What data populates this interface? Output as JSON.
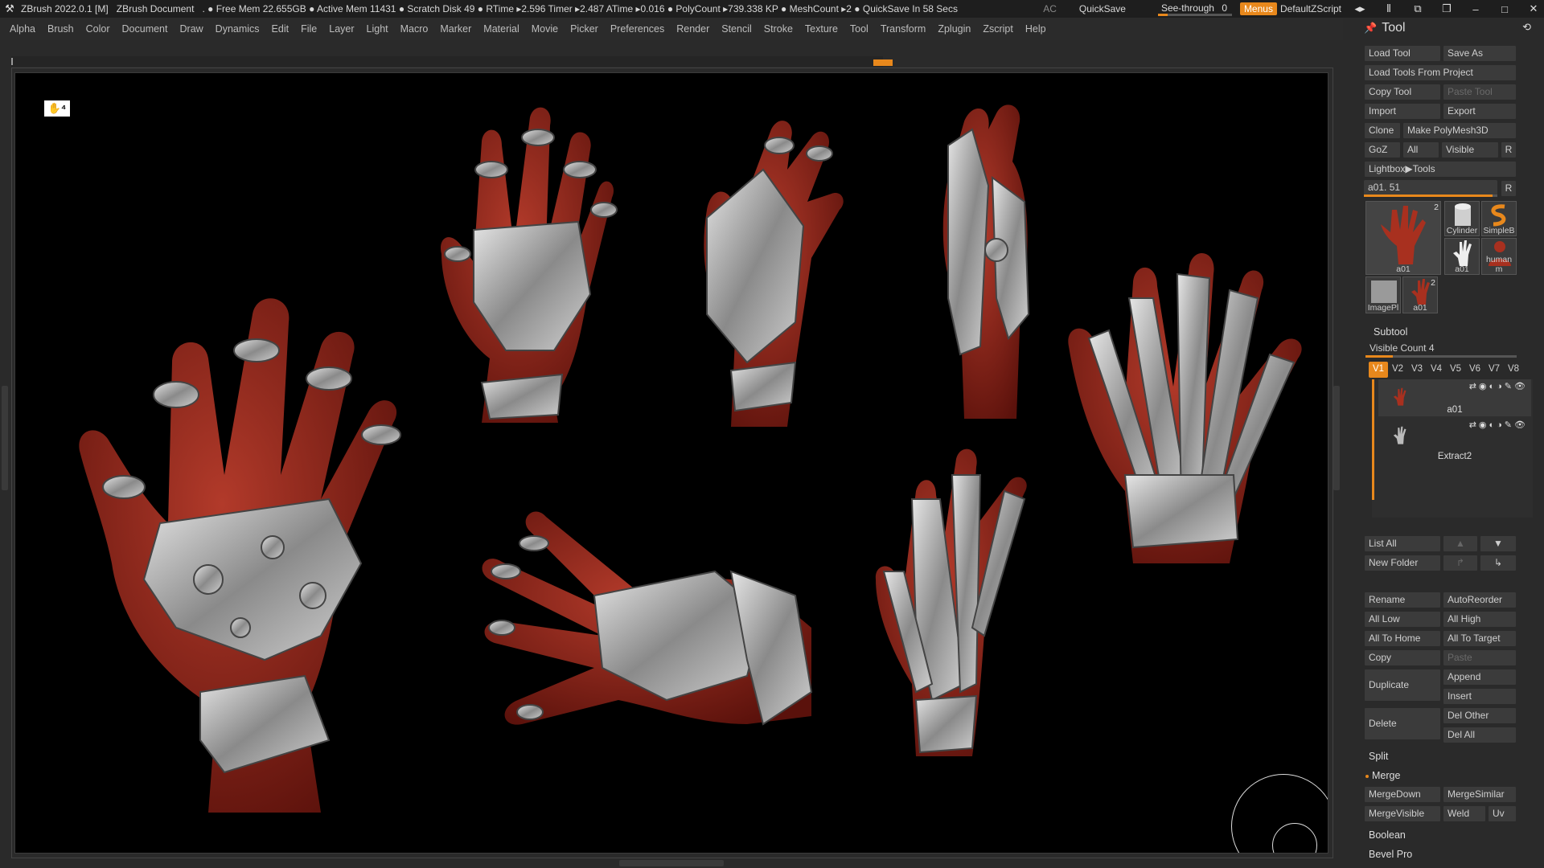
{
  "titlebar": {
    "app": "ZBrush 2022.0.1 [M]",
    "doc": "ZBrush Document",
    "stats": ". ● Free Mem 22.655GB ● Active Mem 11431 ● Scratch Disk 49 ● RTime ▸2.596 Timer ▸2.487 ATime ▸0.016 ● PolyCount ▸739.338 KP ● MeshCount ▸2 ● QuickSave In 58 Secs",
    "ac": "AC",
    "quicksave": "QuickSave",
    "seethrough_label": "See-through",
    "seethrough_value": "0",
    "seethrough_level": 0.0,
    "menus": "Menus",
    "script": "DefaultZScript",
    "icons": [
      "layout-arrows-icon",
      "layout-bars-icon",
      "window-swap-icon",
      "window-restore-icon",
      "minimize-icon",
      "maximize-icon",
      "close-icon"
    ]
  },
  "menubar": [
    "Alpha",
    "Brush",
    "Color",
    "Document",
    "Draw",
    "Dynamics",
    "Edit",
    "File",
    "Layer",
    "Light",
    "Macro",
    "Marker",
    "Material",
    "Movie",
    "Picker",
    "Preferences",
    "Render",
    "Stencil",
    "Stroke",
    "Texture",
    "Tool",
    "Transform",
    "Zplugin",
    "Zscript",
    "Help"
  ],
  "panel": {
    "title": "Tool",
    "buttons": {
      "load_tool": "Load Tool",
      "save_as": "Save As",
      "load_tools_project": "Load Tools From Project",
      "copy_tool": "Copy Tool",
      "paste_tool": "Paste Tool",
      "import": "Import",
      "export": "Export",
      "clone": "Clone",
      "make_polymesh": "Make PolyMesh3D",
      "goz": "GoZ",
      "all": "All",
      "visible": "Visible",
      "r": "R",
      "lightbox_tools": "Lightbox▶Tools"
    },
    "tool_slider": {
      "label": "a01. 51",
      "r": "R"
    },
    "thumbs": [
      {
        "caption": "a01",
        "num": "2"
      },
      {
        "caption": "Cylinder",
        "num": ""
      },
      {
        "caption": "SimpleB",
        "num": ""
      },
      {
        "caption": "a01",
        "num": ""
      },
      {
        "caption": "human m",
        "num": ""
      },
      {
        "caption": "ImagePl",
        "num": ""
      },
      {
        "caption": "a01",
        "num": "2"
      }
    ],
    "subtool": {
      "title": "Subtool",
      "visible_count": "Visible Count 4",
      "vtabs": [
        "V1",
        "V2",
        "V3",
        "V4",
        "V5",
        "V6",
        "V7",
        "V8"
      ],
      "items": [
        {
          "name": "a01"
        },
        {
          "name": "Extract2"
        }
      ],
      "list_all": "List All",
      "new_folder": "New Folder",
      "rename": "Rename",
      "autoreorder": "AutoReorder",
      "all_low": "All Low",
      "all_high": "All High",
      "all_to_home": "All To Home",
      "all_to_target": "All To Target",
      "copy": "Copy",
      "paste": "Paste",
      "duplicate": "Duplicate",
      "append": "Append",
      "insert": "Insert",
      "delete": "Delete",
      "del_other": "Del Other",
      "del_all": "Del All",
      "split": "Split",
      "merge": "Merge",
      "mergedown": "MergeDown",
      "mergesimilar": "MergeSimilar",
      "mergevisible": "MergeVisible",
      "weld": "Weld",
      "uv": "Uv",
      "boolean": "Boolean",
      "bevel_pro": "Bevel Pro"
    }
  },
  "colors": {
    "accent": "#e8881c",
    "skin": "#8e2318",
    "metal": "#b9b9b9",
    "canvas": "#000000"
  }
}
